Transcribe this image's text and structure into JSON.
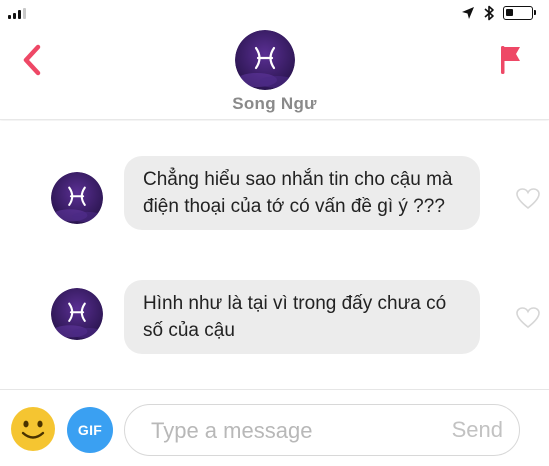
{
  "colors": {
    "accent": "#ee4866",
    "avatar_bg": "#3b1e6b",
    "bubble_bg": "#ececec",
    "gif_blue": "#3aa0f2",
    "emoji_yellow": "#f5c531"
  },
  "status_bar": {
    "battery_level": 0.3,
    "icons": [
      "signal-icon",
      "location-icon",
      "bluetooth-icon",
      "battery-icon"
    ]
  },
  "header": {
    "name": "Song Ngư",
    "back_icon": "chevron-left-icon",
    "report_icon": "flag-icon",
    "avatar_symbol": "pisces-icon"
  },
  "messages": [
    {
      "text": "Chẳng hiểu sao nhắn tin cho cậu mà điện thoại của tớ có vấn đề gì ý ???"
    },
    {
      "text": "Hình như là tại vì trong đấy chưa có số của cậu"
    }
  ],
  "composer": {
    "placeholder": "Type a message",
    "value": "",
    "gif_label": "GIF",
    "send_label": "Send"
  }
}
